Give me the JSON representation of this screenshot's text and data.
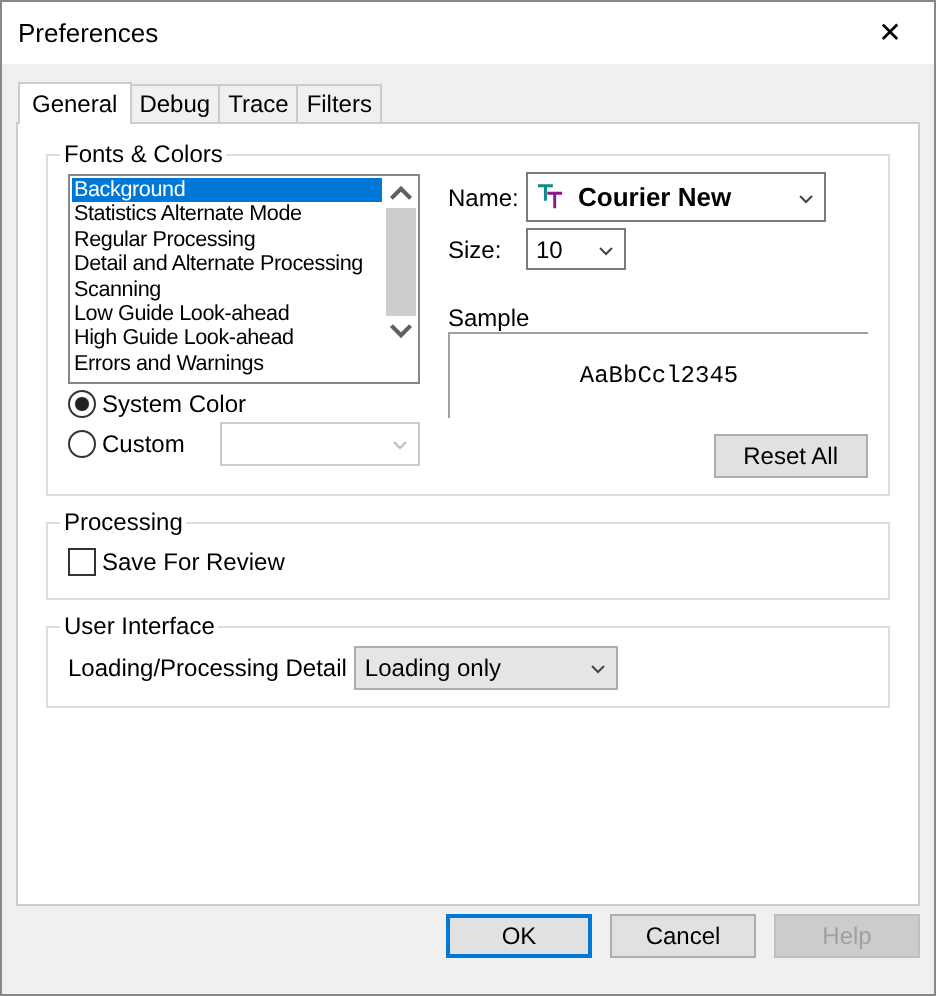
{
  "window": {
    "title": "Preferences",
    "close": "✕"
  },
  "tabs": [
    {
      "label": "General",
      "selected": true
    },
    {
      "label": "Debug",
      "selected": false
    },
    {
      "label": "Trace",
      "selected": false
    },
    {
      "label": "Filters",
      "selected": false
    }
  ],
  "fonts_colors": {
    "title": "Fonts & Colors",
    "items": [
      {
        "label": "Background",
        "selected": true
      },
      {
        "label": "Statistics Alternate Mode",
        "selected": false
      },
      {
        "label": "Regular Processing",
        "selected": false
      },
      {
        "label": "Detail and Alternate Processing",
        "selected": false
      },
      {
        "label": "Scanning",
        "selected": false
      },
      {
        "label": "Low Guide Look-ahead",
        "selected": false
      },
      {
        "label": "High Guide Look-ahead",
        "selected": false
      },
      {
        "label": "Errors and Warnings",
        "selected": false
      }
    ],
    "color_options": [
      {
        "label": "System Color",
        "selected": true
      },
      {
        "label": "Custom",
        "selected": false
      }
    ],
    "name_label": "Name:",
    "name_value": "Courier New",
    "size_label": "Size:",
    "size_value": "10",
    "sample_label": "Sample",
    "sample_text": "AaBbCcl2345",
    "reset_button": "Reset All"
  },
  "processing": {
    "title": "Processing",
    "save_for_review": {
      "label": "Save For Review",
      "checked": false
    }
  },
  "user_interface": {
    "title": "User Interface",
    "detail_label": "Loading/Processing Detail",
    "detail_value": "Loading only"
  },
  "buttons": [
    {
      "label": "OK",
      "default": true,
      "disabled": false
    },
    {
      "label": "Cancel",
      "default": false,
      "disabled": false
    },
    {
      "label": "Help",
      "default": false,
      "disabled": true
    }
  ]
}
